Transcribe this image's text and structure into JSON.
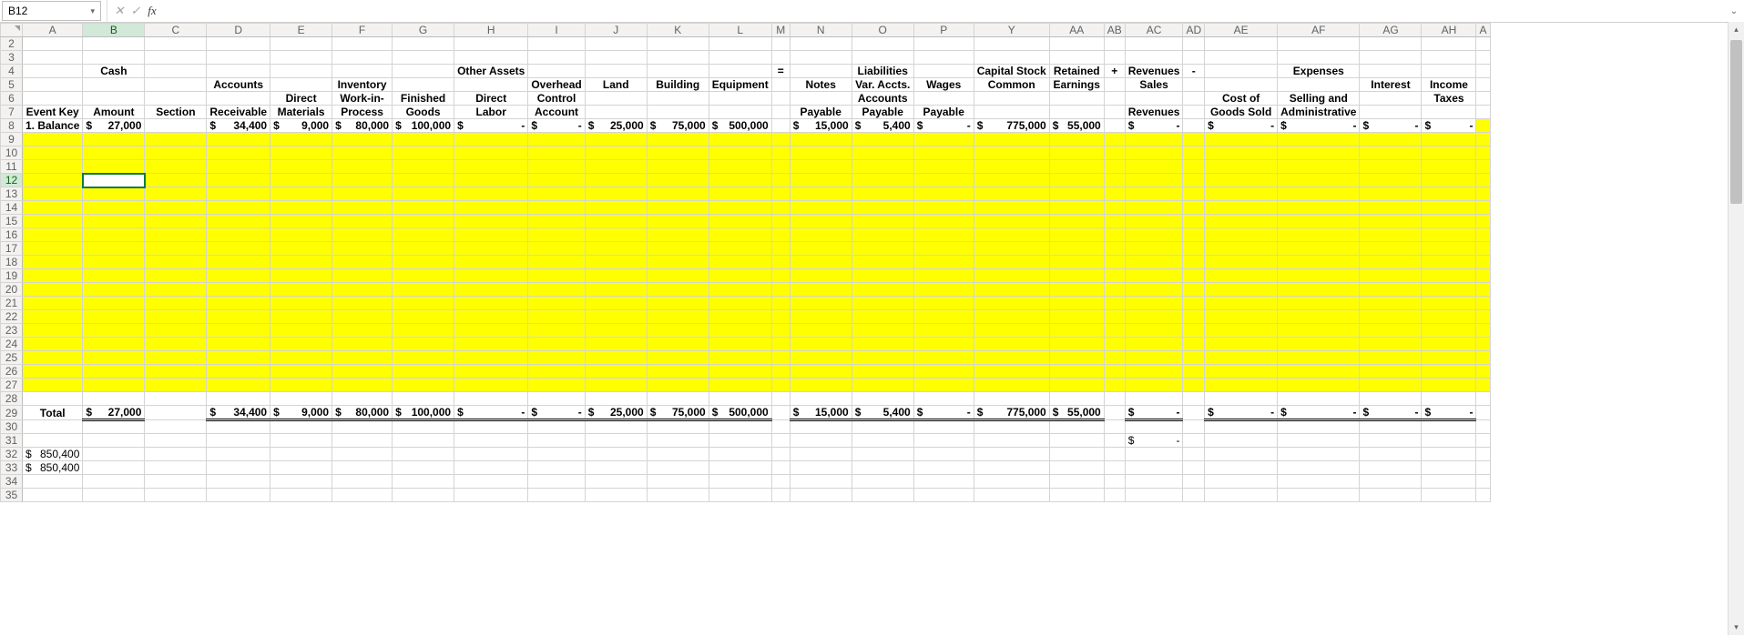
{
  "namebox": "B12",
  "fx_label": "fx",
  "cols": [
    "",
    "A",
    "B",
    "C",
    "D",
    "E",
    "F",
    "G",
    "H",
    "I",
    "J",
    "K",
    "L",
    "M",
    "N",
    "O",
    "P",
    "Y",
    "AA",
    "AB",
    "AC",
    "AD",
    "AE",
    "AF",
    "AG",
    "AH",
    "A"
  ],
  "hdr": {
    "cash": "Cash",
    "other": "Other Assets",
    "eq": "=",
    "liab": "Liabilities",
    "cap": "Capital Stock",
    "ret": "Retained",
    "plus": "+",
    "rev": "Revenues",
    "minus": "-",
    "exp": "Expenses",
    "accts": "Accounts",
    "inv": "Inventory",
    "land": "Land",
    "bldg": "Building",
    "equip": "Equipment",
    "notes": "Notes",
    "var": "Var. Accts.",
    "wages": "Wages",
    "common": "Common",
    "earn": "Earnings",
    "sales": "Sales",
    "interest": "Interest",
    "inc": "Income",
    "dir": "Direct",
    "wip": "Work-in-",
    "fin": "Finished",
    "over": "Overhead",
    "accts2": "Accounts",
    "costof": "Cost of",
    "sell": "Selling and",
    "taxes": "Taxes",
    "ek": "Event Key",
    "amt": "Amount",
    "sec": "Section",
    "recv": "Receivable",
    "mat": "Materials",
    "proc": "Process",
    "goods": "Goods",
    "labor": "Labor",
    "ctrl": "Control",
    "acct": "Account",
    "pay": "Payable",
    "revs": "Revenues",
    "gs": "Goods Sold",
    "adm": "Administrative"
  },
  "row8": {
    "label": "1. Balance",
    "B": "27,000",
    "D": "34,400",
    "E": "9,000",
    "F": "80,000",
    "G": "100,000",
    "H": "-",
    "I": "-",
    "J": "25,000",
    "K": "75,000",
    "L": "500,000",
    "N": "15,000",
    "O": "5,400",
    "P": "-",
    "Y": "775,000",
    "AA": "55,000",
    "AC": "-",
    "AE": "-",
    "AF": "-",
    "AG": "-",
    "AH": "-"
  },
  "row29": {
    "label": "Total",
    "B": "27,000",
    "D": "34,400",
    "E": "9,000",
    "F": "80,000",
    "G": "100,000",
    "H": "-",
    "I": "-",
    "J": "25,000",
    "K": "75,000",
    "L": "500,000",
    "N": "15,000",
    "O": "5,400",
    "P": "-",
    "Y": "775,000",
    "AA": "55,000",
    "AC": "-",
    "AE": "-",
    "AF": "-",
    "AG": "-",
    "AH": "-"
  },
  "row31_AC": "-",
  "row32": "850,400",
  "row33": "850,400",
  "ds": "$"
}
